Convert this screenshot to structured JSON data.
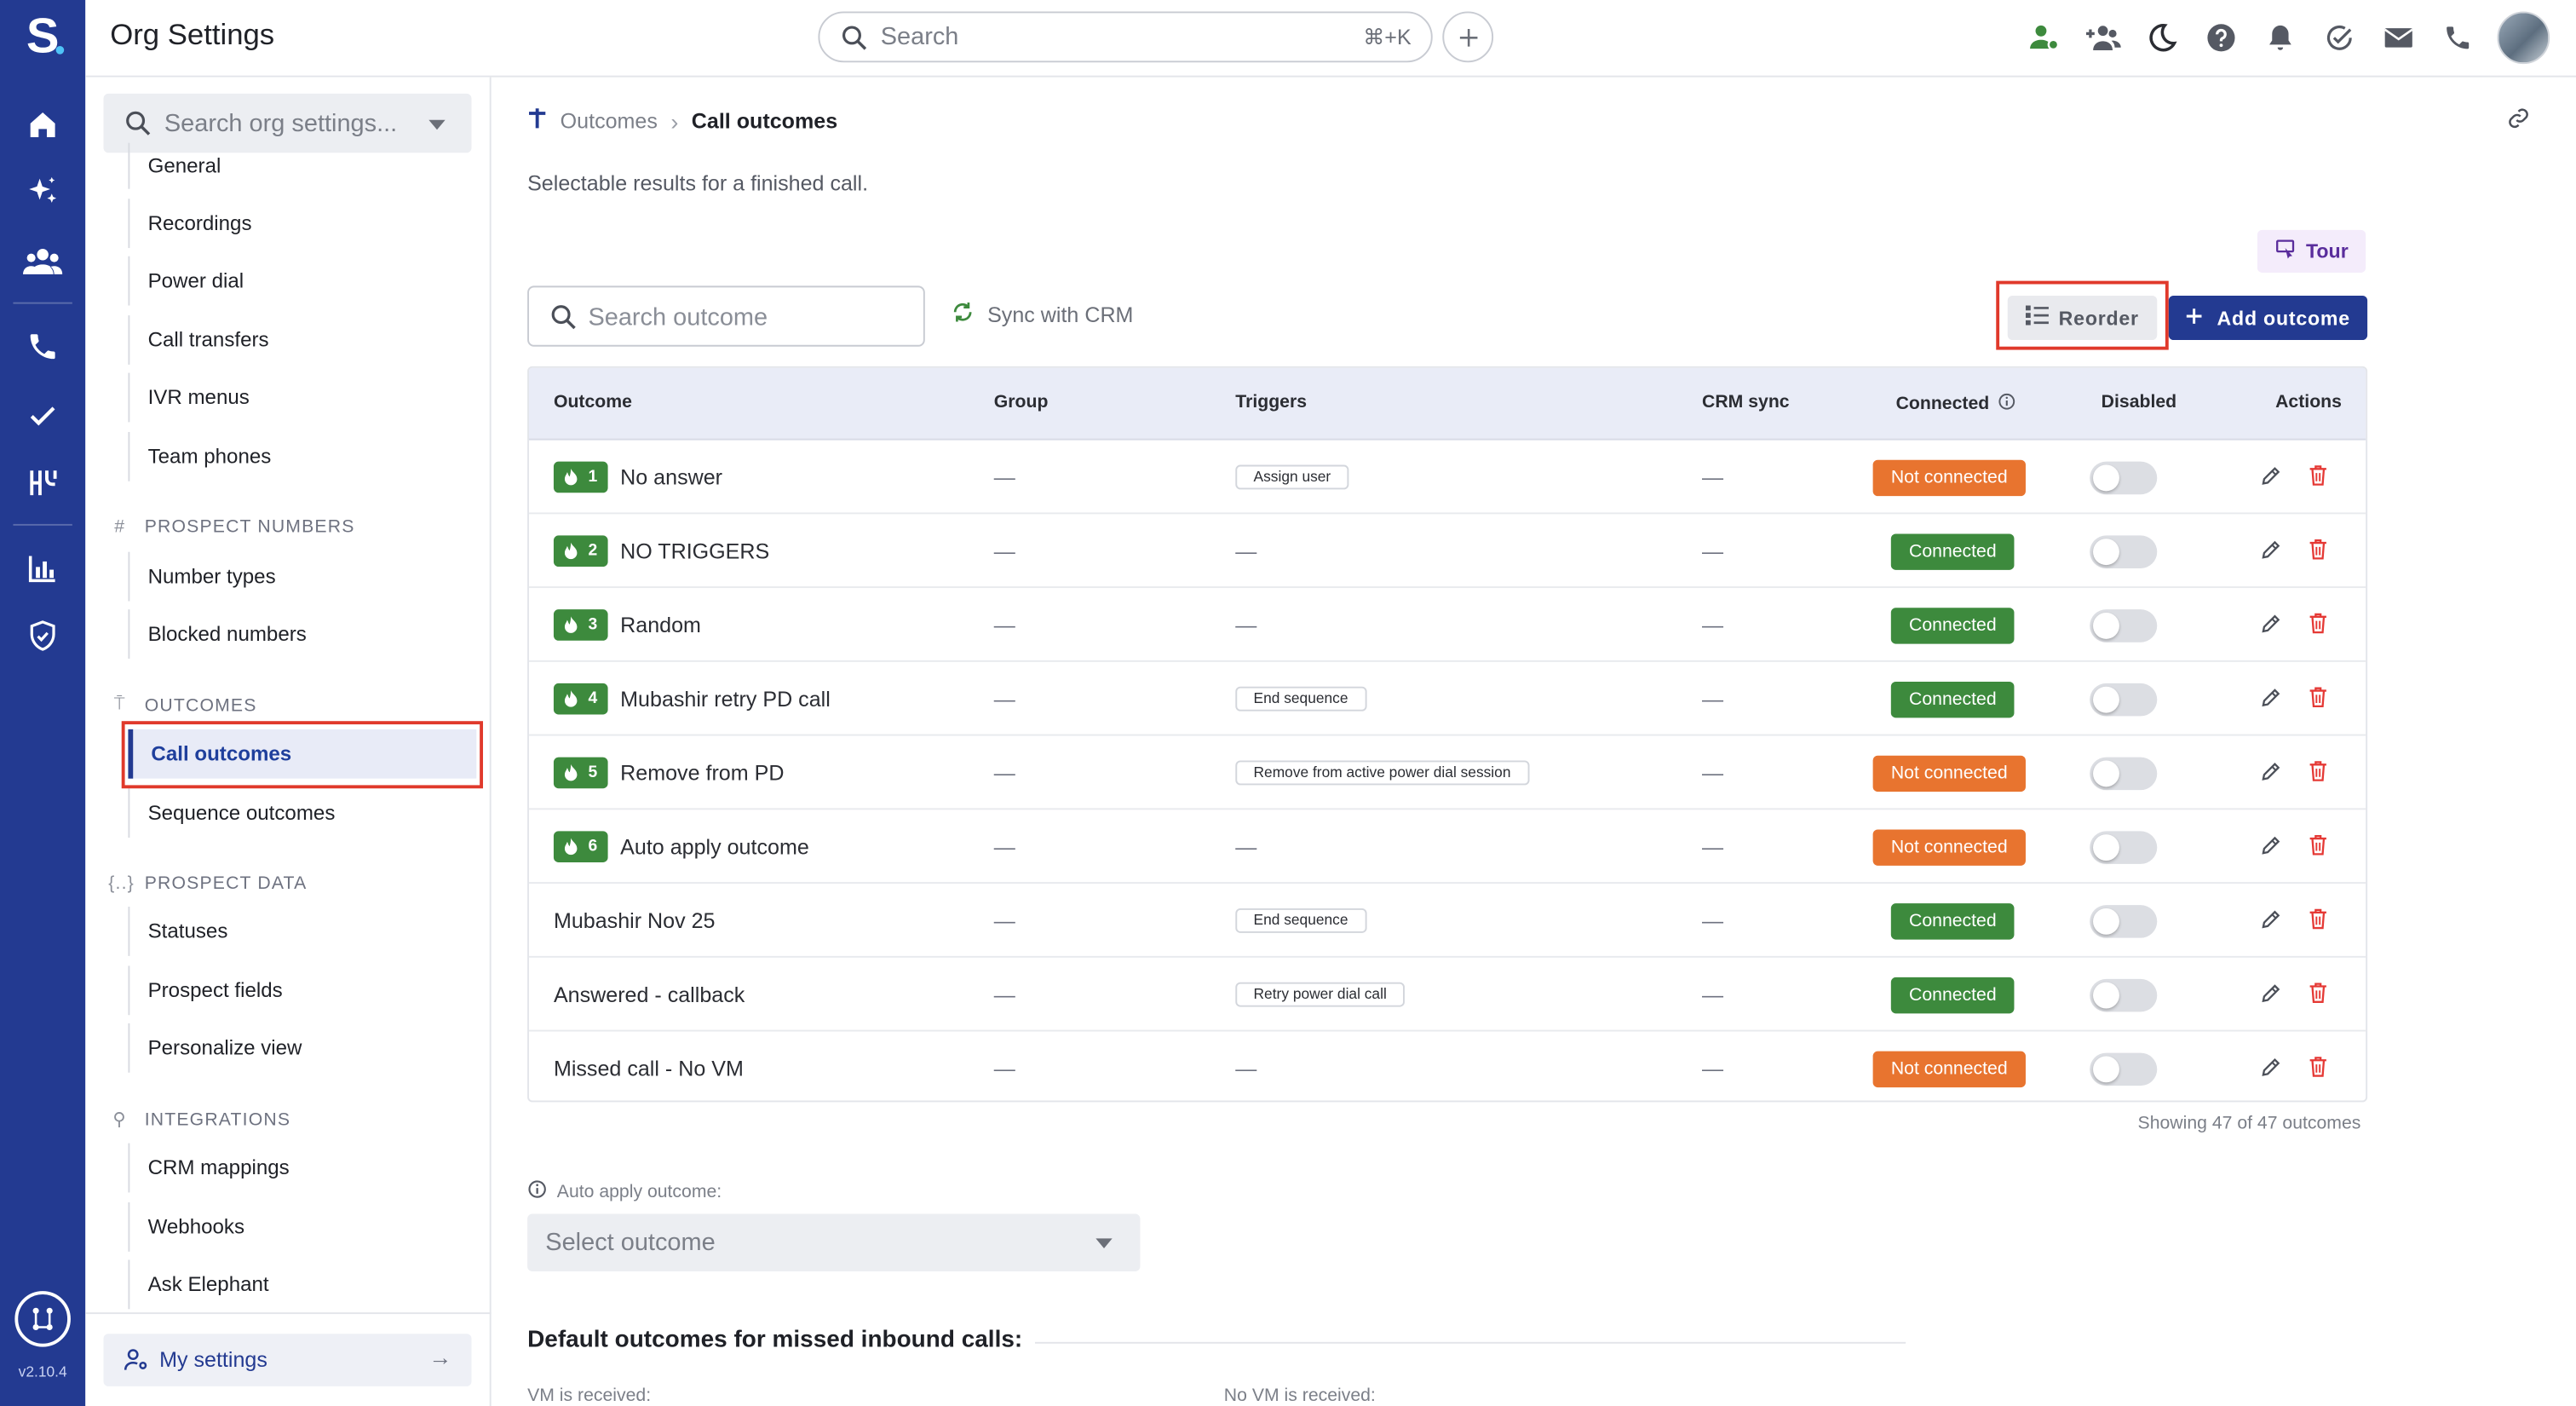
{
  "app": {
    "logo": "S",
    "title": "Org Settings",
    "version": "v2.10.4"
  },
  "topbar": {
    "search_placeholder": "Search",
    "search_shortcut": "⌘+K"
  },
  "sidebar": {
    "search_placeholder": "Search org settings...",
    "items_top": [
      {
        "label": "General"
      },
      {
        "label": "Recordings"
      },
      {
        "label": "Power dial"
      },
      {
        "label": "Call transfers"
      },
      {
        "label": "IVR menus"
      },
      {
        "label": "Team phones"
      }
    ],
    "sections": [
      {
        "title": "PROSPECT NUMBERS",
        "icon": "#",
        "items": [
          {
            "label": "Number types"
          },
          {
            "label": "Blocked numbers"
          }
        ]
      },
      {
        "title": "OUTCOMES",
        "icon": "⍑",
        "items": [
          {
            "label": "Call outcomes"
          },
          {
            "label": "Sequence outcomes"
          }
        ]
      },
      {
        "title": "PROSPECT DATA",
        "icon": "{..}",
        "items": [
          {
            "label": "Statuses"
          },
          {
            "label": "Prospect fields"
          },
          {
            "label": "Personalize view"
          }
        ]
      },
      {
        "title": "INTEGRATIONS",
        "icon": "⚲",
        "items": [
          {
            "label": "CRM mappings"
          },
          {
            "label": "Webhooks"
          },
          {
            "label": "Ask Elephant"
          }
        ]
      }
    ],
    "my_settings": "My settings"
  },
  "main": {
    "breadcrumb": {
      "parent": "Outcomes",
      "current": "Call outcomes"
    },
    "description": "Selectable results for a finished call.",
    "tour_label": "Tour",
    "search_placeholder": "Search outcome",
    "sync_label": "Sync with CRM",
    "reorder_label": "Reorder",
    "add_label": "Add outcome",
    "columns": [
      "Outcome",
      "Group",
      "Triggers",
      "CRM sync",
      "Connected",
      "Disabled",
      "Actions"
    ],
    "rows": [
      {
        "badge": "1",
        "name": "No answer",
        "group": "—",
        "trigger": "Assign user",
        "crm": "—",
        "status": "Not connected",
        "connected": false
      },
      {
        "badge": "2",
        "name": "NO TRIGGERS",
        "group": "—",
        "trigger": "",
        "crm": "—",
        "status": "Connected",
        "connected": true
      },
      {
        "badge": "3",
        "name": "Random",
        "group": "—",
        "trigger": "",
        "crm": "—",
        "status": "Connected",
        "connected": true
      },
      {
        "badge": "4",
        "name": "Mubashir retry PD call",
        "group": "—",
        "trigger": "End sequence",
        "crm": "—",
        "status": "Connected",
        "connected": true
      },
      {
        "badge": "5",
        "name": "Remove from PD",
        "group": "—",
        "trigger": "Remove from active power dial session",
        "crm": "—",
        "status": "Not connected",
        "connected": false
      },
      {
        "badge": "6",
        "name": "Auto apply outcome",
        "group": "—",
        "trigger": "",
        "crm": "—",
        "status": "Not connected",
        "connected": false
      },
      {
        "badge": "",
        "name": "Mubashir Nov 25",
        "group": "—",
        "trigger": "End sequence",
        "crm": "—",
        "status": "Connected",
        "connected": true
      },
      {
        "badge": "",
        "name": "Answered - callback",
        "group": "—",
        "trigger": "Retry power dial call",
        "crm": "—",
        "status": "Connected",
        "connected": true
      },
      {
        "badge": "",
        "name": "Missed call - No VM",
        "group": "—",
        "trigger": "",
        "crm": "—",
        "status": "Not connected",
        "connected": false
      }
    ],
    "empty_trigger": "—",
    "showing": "Showing 47 of 47 outcomes",
    "auto_apply_label": "Auto apply outcome:",
    "auto_apply_placeholder": "Select outcome",
    "default_title": "Default outcomes for missed inbound calls:",
    "vm_received": "VM is received:",
    "no_vm_received": "No VM is received:"
  },
  "colors": {
    "rail": "#233a91",
    "primary": "#233a91",
    "connected": "#3d8a3d",
    "not_connected": "#e8742f",
    "delete": "#e53935",
    "highlight": "#e0392b",
    "tour_bg": "#f4ecfb"
  }
}
